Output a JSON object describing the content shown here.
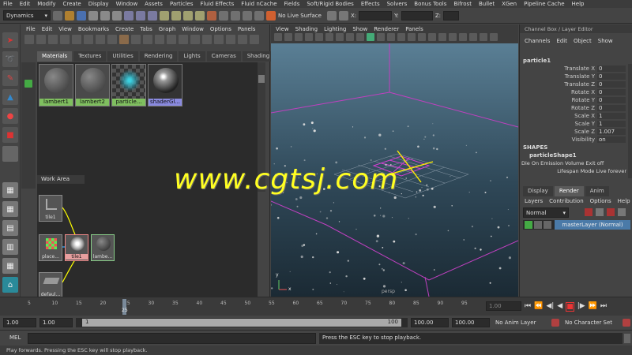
{
  "menubar": {
    "items": [
      "File",
      "Edit",
      "Modify",
      "Create",
      "Display",
      "Window",
      "Assets",
      "Particles",
      "Fluid Effects",
      "Fluid nCache",
      "Fields",
      "Soft/Rigid Bodies",
      "Effects",
      "Solvers",
      "Bonus Tools",
      "Bifrost",
      "Bullet",
      "XGen",
      "Pipeline Cache",
      "Help"
    ]
  },
  "statusline": {
    "menu_set": "Dynamics",
    "live_surface": "No Live Surface",
    "x_label": "X:",
    "y_label": "Y:",
    "z_label": "Z:"
  },
  "hypershade": {
    "menu": [
      "File",
      "Edit",
      "View",
      "Bookmarks",
      "Create",
      "Tabs",
      "Graph",
      "Window",
      "Options",
      "Panels"
    ],
    "tabs": [
      "Materials",
      "Textures",
      "Utilities",
      "Rendering",
      "Lights",
      "Cameras",
      "Shading"
    ],
    "swatches": [
      "lambert1",
      "lambert2",
      "particle...",
      "shaderGl..."
    ],
    "work_area_label": "Work Area",
    "nodes": [
      "tile1",
      "place...",
      "tile1",
      "lambe...",
      "defaul..."
    ]
  },
  "viewport": {
    "menu": [
      "View",
      "Shading",
      "Lighting",
      "Show",
      "Renderer",
      "Panels"
    ],
    "camera_label": "persp",
    "axis_y": "y",
    "axis_x": "x"
  },
  "channel_box": {
    "header": "Channel Box / Layer Editor",
    "menu": [
      "Channels",
      "Edit",
      "Object",
      "Show"
    ],
    "object_name": "particle1",
    "attributes": [
      {
        "name": "Translate X",
        "value": "0"
      },
      {
        "name": "Translate Y",
        "value": "0"
      },
      {
        "name": "Translate Z",
        "value": "0"
      },
      {
        "name": "Rotate X",
        "value": "0"
      },
      {
        "name": "Rotate Y",
        "value": "0"
      },
      {
        "name": "Rotate Z",
        "value": "0"
      },
      {
        "name": "Scale X",
        "value": "1"
      },
      {
        "name": "Scale Y",
        "value": "1"
      },
      {
        "name": "Scale Z",
        "value": "1.007"
      },
      {
        "name": "Visibility",
        "value": "on"
      }
    ],
    "shapes_label": "SHAPES",
    "shape_name": "particleShape1",
    "shape_attrs": [
      {
        "name": "Die On Emission Volume Exit",
        "value": "off"
      },
      {
        "name": "Lifespan Mode",
        "value": "Live forever"
      }
    ]
  },
  "layer_editor": {
    "tabs": [
      "Display",
      "Render",
      "Anim"
    ],
    "menu": [
      "Layers",
      "Contribution",
      "Options",
      "Help"
    ],
    "mode": "Normal",
    "layer": "masterLayer (Normal)"
  },
  "timeline": {
    "ticks": [
      "5",
      "10",
      "15",
      "20",
      "25",
      "30",
      "35",
      "40",
      "45",
      "50",
      "55",
      "60",
      "65",
      "70",
      "75",
      "80",
      "85",
      "90",
      "95"
    ],
    "current_frame": "25",
    "end_field": "1.00"
  },
  "range": {
    "start": "1.00",
    "range_start": "1.00",
    "slider_start": "1",
    "slider_end": "100",
    "range_end": "100.00",
    "end": "100.00",
    "anim_layer": "No Anim Layer",
    "character_set": "No Character Set"
  },
  "command": {
    "label": "MEL",
    "feedback": "Press the ESC key to stop playback."
  },
  "help_line": "Play forwards. Pressing the ESC key will stop playback.",
  "watermark": "www.cgtsj.com"
}
